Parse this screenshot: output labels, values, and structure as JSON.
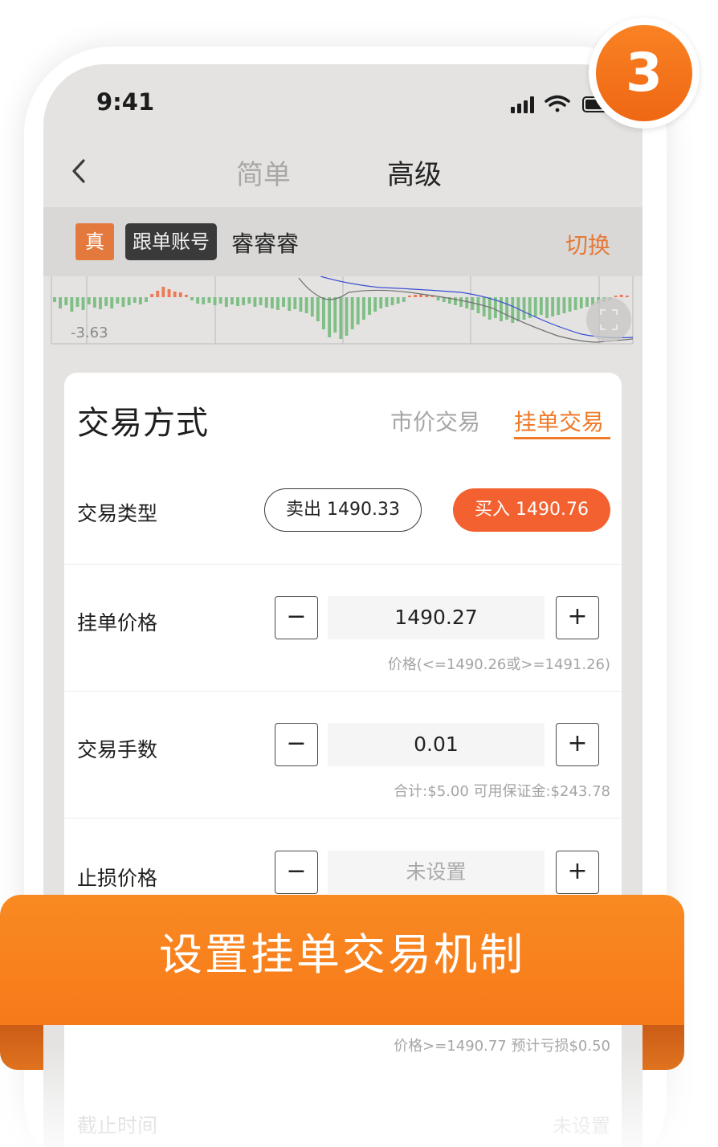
{
  "status_bar": {
    "time": "9:41"
  },
  "nav": {
    "tab_simple": "简单",
    "tab_advanced": "高级"
  },
  "account": {
    "real_badge": "真",
    "follow_badge": "跟单账号",
    "name": "睿睿睿",
    "switch_label": "切换"
  },
  "chart": {
    "value_label": "-3.63"
  },
  "card": {
    "title": "交易方式",
    "mode_market": "市价交易",
    "mode_pending": "挂单交易"
  },
  "trade_type": {
    "label": "交易类型",
    "sell_label": "卖出 1490.33",
    "buy_label": "买入 1490.76"
  },
  "pending_price": {
    "label": "挂单价格",
    "value": "1490.27",
    "hint": "价格(<=1490.26或>=1491.26)"
  },
  "lots": {
    "label": "交易手数",
    "value": "0.01",
    "hint": "合计:$5.00 可用保证金:$243.78"
  },
  "stop_loss": {
    "label": "止损价格",
    "placeholder": "未设置",
    "hint": "价格>=1490.77 预计亏损$0.50"
  },
  "expiry": {
    "label": "截止时间",
    "value": "未设置"
  },
  "stepper": {
    "minus": "−",
    "plus": "+"
  },
  "banner": {
    "text": "设置挂单交易机制"
  },
  "step_badge": {
    "number": "3"
  },
  "colors": {
    "accent": "#f07a28",
    "buy": "#f2612f",
    "bar_green": "#7fbf86",
    "bar_red": "#ee7b55"
  }
}
